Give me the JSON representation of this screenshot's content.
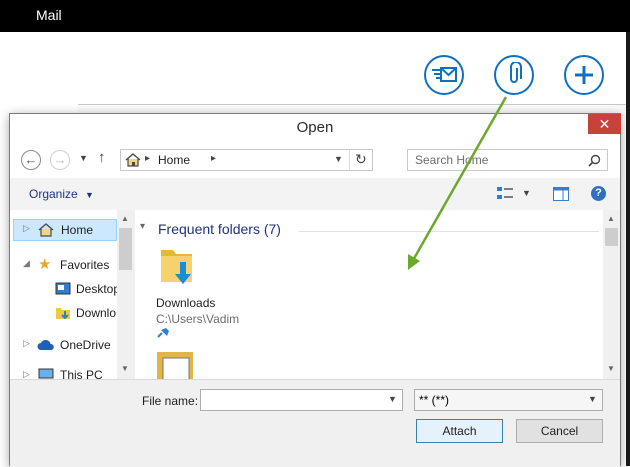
{
  "app": {
    "title": "Mail"
  },
  "dialog": {
    "title": "Open",
    "close_glyph": "✕",
    "address": {
      "segment": "Home",
      "separator": "▸"
    },
    "search_placeholder": "Search Home",
    "organize_label": "Organize",
    "sidebar": [
      {
        "label": "Home",
        "icon": "home-icon"
      },
      {
        "label": "Favorites",
        "icon": "star-icon"
      },
      {
        "label": "Desktop",
        "icon": "desktop-icon"
      },
      {
        "label": "Downlo",
        "icon": "downloads-folder-icon"
      },
      {
        "label": "OneDrive",
        "icon": "cloud-icon"
      },
      {
        "label": "This PC",
        "icon": "computer-icon"
      }
    ],
    "content": {
      "group_title": "Frequent folders (7)",
      "items": [
        {
          "name": "Downloads",
          "path": "C:\\Users\\Vadim",
          "pinned": true
        }
      ]
    },
    "filename_label": "File name:",
    "filename_value": "",
    "filetype_value": "** (**)",
    "attach_label": "Attach",
    "cancel_label": "Cancel"
  },
  "colors": {
    "accent": "#1070c0",
    "arrow": "#6aa82e",
    "close": "#c7423b",
    "group_title": "#1e3287"
  }
}
